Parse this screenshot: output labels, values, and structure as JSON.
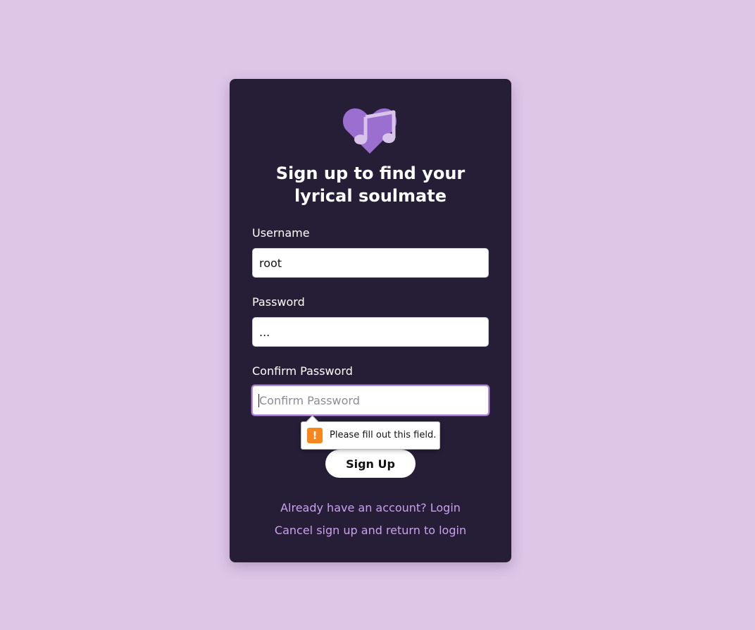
{
  "theme": {
    "background": "#dec6e7",
    "card": "#261d37",
    "accent": "#9b6fd0",
    "link": "#c9a2ec",
    "focus_ring": "#b58ae0",
    "warning": "#f7861c"
  },
  "logo": {
    "icon": "heart-music-note-icon"
  },
  "title": {
    "line1": "Sign up to find your",
    "line2": "lyrical soulmate"
  },
  "form": {
    "username": {
      "label": "Username",
      "value": "root"
    },
    "password": {
      "label": "Password",
      "value": "..."
    },
    "confirm_password": {
      "label": "Confirm Password",
      "value": "",
      "placeholder": "Confirm Password"
    }
  },
  "validation": {
    "icon": "warning-icon",
    "icon_glyph": "!",
    "message": "Please fill out this field."
  },
  "actions": {
    "signup_label": "Sign Up",
    "login_link": "Already have an account? Login",
    "cancel_link": "Cancel sign up and return to login"
  }
}
